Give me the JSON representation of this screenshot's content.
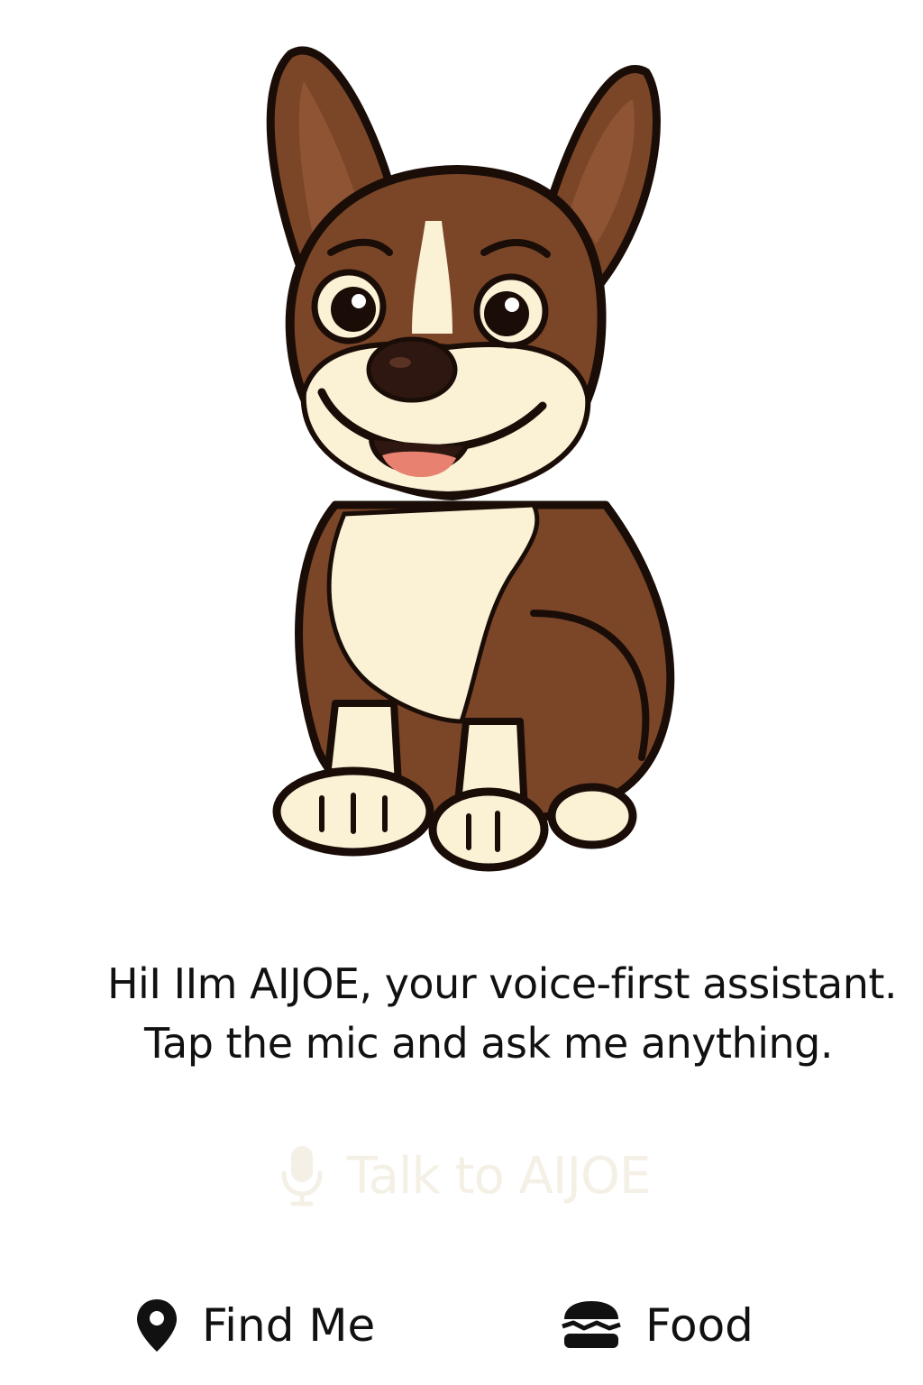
{
  "mascot": {
    "name": "dog-mascot",
    "colors": {
      "fur": "#7b4628",
      "cream": "#fbf1d5",
      "outline": "#1a0d07",
      "tongue": "#e8816f",
      "nose": "#2d1710"
    }
  },
  "greeting": {
    "line1": "HiI IIm AIJOE, your voice-first assistant.",
    "line2": "Tap the mic and ask me anything."
  },
  "talk_button": {
    "icon": "microphone-icon",
    "label": "Talk to AIJOE",
    "color": "#f4f0e6"
  },
  "bottom_nav": {
    "items": [
      {
        "icon": "location-pin-icon",
        "label": "Find Me"
      },
      {
        "icon": "burger-icon",
        "label": "Food"
      }
    ]
  }
}
